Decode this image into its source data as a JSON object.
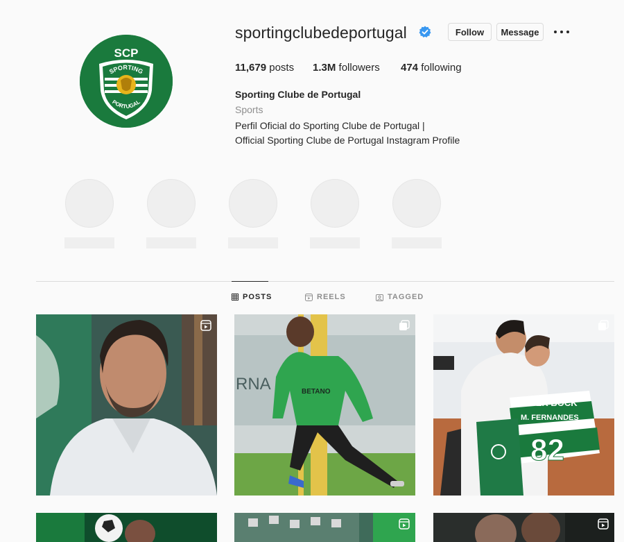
{
  "profile": {
    "username": "sportingclubedeportugal",
    "full_name": "Sporting Clube de Portugal",
    "category": "Sports",
    "bio_line1": "Perfil Oficial do Sporting Clube de Portugal |",
    "bio_line2": "Official Sporting Clube de Portugal Instagram Profile",
    "verified": true,
    "logo_text": "SCP",
    "logo_ring_top": "SPORTING",
    "logo_ring_bottom": "PORTUGAL"
  },
  "actions": {
    "follow_label": "Follow",
    "message_label": "Message"
  },
  "stats": {
    "posts_value": "11,679",
    "posts_label": "posts",
    "followers_value": "1.3M",
    "followers_label": "followers",
    "following_value": "474",
    "following_label": "following"
  },
  "highlights_count": 5,
  "tabs": {
    "posts": "POSTS",
    "reels": "REELS",
    "tagged": "TAGGED"
  },
  "posts": [
    {
      "badge": "reel-icon"
    },
    {
      "badge": "carousel-icon",
      "banner_text": "RNA",
      "shirt_text": "BETANO"
    },
    {
      "badge": "carousel-icon",
      "jersey_sponsor": "SUPER BOCK",
      "jersey_name": "M. FERNANDES",
      "jersey_number": "82"
    },
    {
      "badge": ""
    },
    {
      "badge": "reel-icon"
    },
    {
      "badge": "reel-icon"
    }
  ],
  "colors": {
    "brand_green": "#1a7a3d",
    "verified_blue": "#3897f0",
    "muted": "#8e8e8e",
    "border": "#dbdbdb"
  }
}
